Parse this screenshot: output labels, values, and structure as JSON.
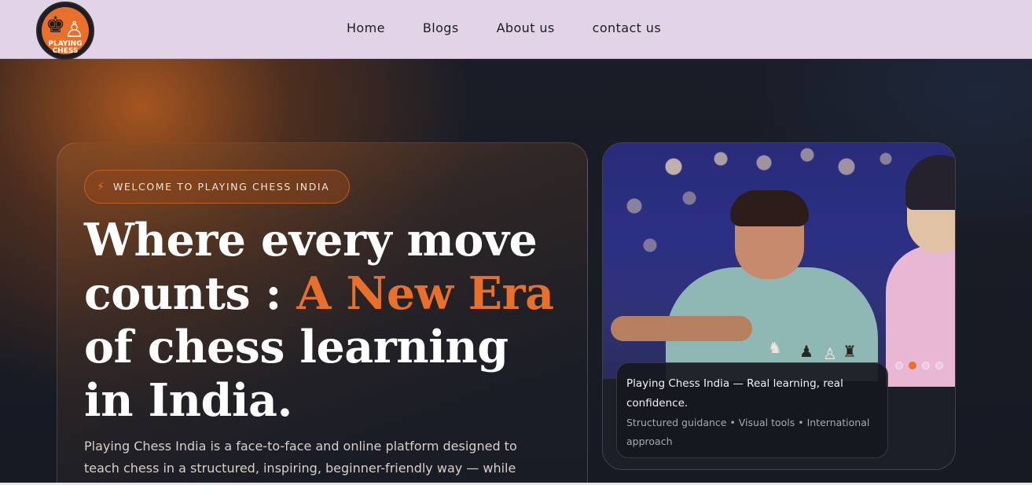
{
  "brand": {
    "logo_text_line1": "PLAYING",
    "logo_text_line2": "CHESS"
  },
  "nav": {
    "items": [
      {
        "label": "Home"
      },
      {
        "label": "Blogs"
      },
      {
        "label": "About us"
      },
      {
        "label": "contact us"
      }
    ]
  },
  "hero": {
    "badge_icon": "lightning-icon",
    "badge_text": "WELCOME TO PLAYING CHESS INDIA",
    "headline_before": "Where every move counts : ",
    "headline_accent": "A New Era",
    "headline_after": " of chess learning in India.",
    "lead": "Playing Chess India is a face-to-face and online platform designed to teach chess in a structured, inspiring, beginner-friendly way — while building real-"
  },
  "showcase": {
    "caption_title": "Playing Chess India — Real learning, real confidence.",
    "caption_sub": "Structured guidance • Visual tools • International approach",
    "slide_count": 4,
    "active_slide": 2
  },
  "colors": {
    "accent": "#e8702a",
    "header_bg": "#e2d3e6",
    "page_bg": "#141821"
  }
}
